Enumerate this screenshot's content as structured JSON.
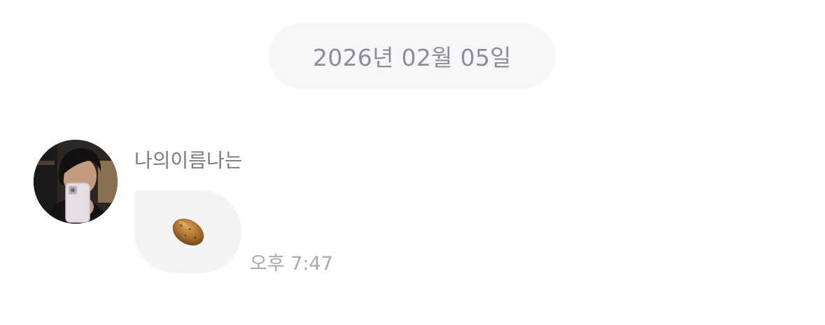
{
  "date_separator": {
    "label": "2026년 02월 05일"
  },
  "message": {
    "sender_name": "나의이름나는",
    "content_icon": "potato-emoji",
    "time": "오후 7:47"
  },
  "colors": {
    "date_pill_bg": "#f7f7fa",
    "date_text": "#8c8d96",
    "bubble_bg": "#f3f3f6",
    "sender_text": "#7b7b82",
    "time_text": "#a9a9b0"
  }
}
